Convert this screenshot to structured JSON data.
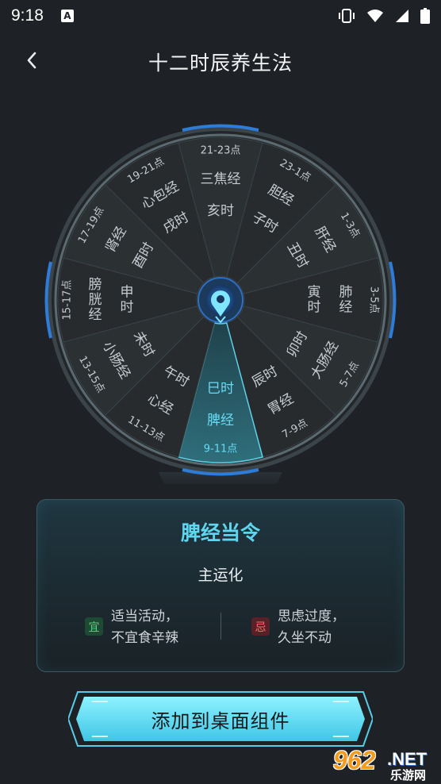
{
  "status_bar": {
    "time": "9:18",
    "notification_icon": "a-notification-icon",
    "icons": [
      "vibrate-icon",
      "wifi-icon",
      "signal-icon",
      "battery-icon"
    ]
  },
  "header": {
    "back_icon": "chevron-left-icon",
    "title": "十二时辰养生法"
  },
  "wheel": {
    "active_index": 6,
    "colors": {
      "segment": "#2b3033",
      "segment_alt": "#272b2e",
      "active_segment": "#2a5e6a",
      "ring": "#566770",
      "accent": "#2f7bd8",
      "text": "#c5cdd2",
      "active_text": "#66dcf5"
    },
    "center_icon": "location-pin-icon",
    "segments": [
      {
        "hour": "亥时",
        "meridian": "三焦经",
        "time": "21-23点"
      },
      {
        "hour": "子时",
        "meridian": "胆经",
        "time": "23-1点"
      },
      {
        "hour": "丑时",
        "meridian": "肝经",
        "time": "1-3点"
      },
      {
        "hour": "寅时",
        "meridian": "肺经",
        "time": "3-5点"
      },
      {
        "hour": "卯时",
        "meridian": "大肠经",
        "time": "5-7点"
      },
      {
        "hour": "辰时",
        "meridian": "胃经",
        "time": "7-9点"
      },
      {
        "hour": "巳时",
        "meridian": "脾经",
        "time": "9-11点"
      },
      {
        "hour": "午时",
        "meridian": "心经",
        "time": "11-13点"
      },
      {
        "hour": "未时",
        "meridian": "小肠经",
        "time": "13-15点"
      },
      {
        "hour": "申时",
        "meridian": "膀胱经",
        "time": "15-17点"
      },
      {
        "hour": "酉时",
        "meridian": "肾经",
        "time": "17-19点"
      },
      {
        "hour": "戌时",
        "meridian": "心包经",
        "time": "19-21点"
      }
    ]
  },
  "card": {
    "title": "脾经当令",
    "subtitle": "主运化",
    "yi": {
      "badge": "宜",
      "line1": "适当活动，",
      "line2": "不宜食辛辣"
    },
    "ji": {
      "badge": "忌",
      "line1": "思虑过度，",
      "line2": "久坐不动"
    }
  },
  "action": {
    "label": "添加到桌面组件"
  },
  "watermark": {
    "number": "962",
    "domain": ".NET",
    "subtitle": "乐游网"
  }
}
